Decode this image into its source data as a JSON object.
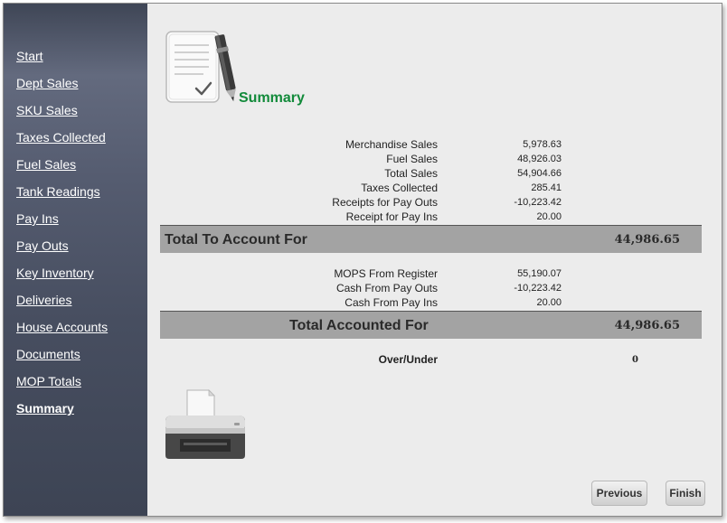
{
  "sidebar": {
    "items": [
      {
        "label": "Start"
      },
      {
        "label": "Dept Sales"
      },
      {
        "label": "SKU Sales"
      },
      {
        "label": "Taxes Collected"
      },
      {
        "label": "Fuel Sales"
      },
      {
        "label": "Tank Readings"
      },
      {
        "label": "Pay Ins"
      },
      {
        "label": "Pay Outs"
      },
      {
        "label": "Key Inventory"
      },
      {
        "label": "Deliveries"
      },
      {
        "label": "House Accounts"
      },
      {
        "label": "Documents"
      },
      {
        "label": "MOP Totals"
      },
      {
        "label": "Summary"
      }
    ],
    "active": "Summary"
  },
  "header": {
    "title": "Summary",
    "icon": "document-checklist-pen-icon"
  },
  "summary": {
    "account_rows": [
      {
        "label": "Merchandise Sales",
        "value": "5,978.63"
      },
      {
        "label": "Fuel Sales",
        "value": "48,926.03"
      },
      {
        "label": "Total Sales",
        "value": "54,904.66"
      },
      {
        "label": "Taxes Collected",
        "value": "285.41"
      },
      {
        "label": "Receipts for Pay Outs",
        "value": "-10,223.42"
      },
      {
        "label": "Receipt for Pay Ins",
        "value": "20.00"
      }
    ],
    "total_to_account": {
      "label": "Total To Account For",
      "value": "44,986.65"
    },
    "accounted_rows": [
      {
        "label": "MOPS From Register",
        "value": "55,190.07"
      },
      {
        "label": "Cash From Pay Outs",
        "value": "-10,223.42"
      },
      {
        "label": "Cash From Pay Ins",
        "value": "20.00"
      }
    ],
    "total_accounted": {
      "label": "Total Accounted For",
      "value": "44,986.65"
    },
    "over_under": {
      "label": "Over/Under",
      "value": "0"
    }
  },
  "print": {
    "icon": "printer-icon"
  },
  "footer": {
    "previous_label": "Previous",
    "finish_label": "Finish"
  },
  "colors": {
    "sidebar": "#4a5163",
    "title_green": "#128a3a",
    "total_bar": "#a3a3a3",
    "content_bg": "#ececec"
  }
}
